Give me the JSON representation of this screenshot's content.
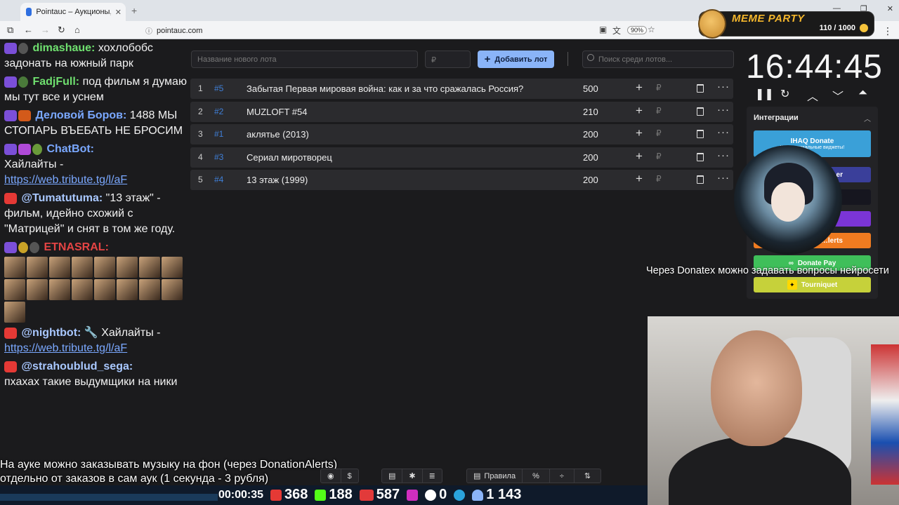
{
  "browser": {
    "tab_title": "Pointauc – Аукционы, лотереи",
    "url": "pointauc.com",
    "zoom": "90%"
  },
  "meme_party": {
    "title": "MEME PARTY",
    "count": "110 / 1000"
  },
  "chat": {
    "messages": [
      {
        "author": "dimashaue:",
        "author_color": "#6fe06f",
        "text": "хохлобобс задонать на южный парк"
      },
      {
        "author": "FadjFull:",
        "author_color": "#6fe06f",
        "text": "под фильм я думаю мы тут все и уснем"
      },
      {
        "author": "Деловой Боров:",
        "author_color": "#7aa8ff",
        "text": "1488 МЫ СТОПАРЬ ВЪЕБАТЬ НЕ БРОСИМ"
      },
      {
        "author": "ChatBot:",
        "author_color": "#7aa8ff",
        "text": "Хайлайты -",
        "link": "https://web.tribute.tg/l/aF"
      },
      {
        "author": "@Tumatutuma:",
        "author_color": "#a9c8ff",
        "text": "\"13 этаж\" - фильм, идейно схожий с \"Матрицей\" и снят в том же году."
      },
      {
        "author": "ЕTNASRAL:",
        "author_color": "#e54444",
        "text": ""
      },
      {
        "author": "@nightbot:",
        "author_color": "#a9c8ff",
        "text": "Хайлайты -",
        "link": "https://web.tribute.tg/l/aF"
      },
      {
        "author": "@strahoublud_sega:",
        "author_color": "#a9c8ff",
        "text": "пхахах такие выдумщики на ники"
      }
    ]
  },
  "form": {
    "lot_placeholder": "Название нового лота",
    "amount_placeholder": "₽",
    "add_label": "Добавить лот",
    "search_placeholder": "Поиск среди лотов..."
  },
  "lots": [
    {
      "num": "1",
      "rank": "#5",
      "name": "Забытая Первая мировая война: как и за что сражалась Россия?",
      "amount": "500"
    },
    {
      "num": "2",
      "rank": "#2",
      "name": "MUZLOFT #54",
      "amount": "210"
    },
    {
      "num": "3",
      "rank": "#1",
      "name": "аклятье (2013)",
      "amount": "200"
    },
    {
      "num": "4",
      "rank": "#3",
      "name": "Сериал миротворец",
      "amount": "200"
    },
    {
      "num": "5",
      "rank": "#4",
      "name": "13 этаж (1999)",
      "amount": "200"
    }
  ],
  "timer": {
    "value": "16:44:45"
  },
  "integrations": {
    "title": "Интеграции",
    "buttons": [
      {
        "label": "IHAQ Donate",
        "sub": "Ко… …никальные виджеты!",
        "color": "#3aa0d8"
      },
      {
        "label": "…er",
        "color": "#3a3f9a"
      },
      {
        "label": "",
        "color": "#1a1a2a"
      },
      {
        "label": "",
        "color": "#7b35d6"
      },
      {
        "label": "…lerts",
        "color": "#f07b20"
      },
      {
        "label": "Donate Pay",
        "color": "#3fbf5a"
      },
      {
        "label": "Tourniquet",
        "color": "#c6d13a"
      }
    ]
  },
  "captions": {
    "right": "Через Donatex можно задавать вопросы нейросети",
    "bottom_line1": "На ауке можно заказывать музыку на фон (через DonationAlerts)",
    "bottom_line2": "отдельно от заказов в сам аук (1 секунда - 3 рубля)"
  },
  "toolbar": {
    "rules_label": "Правила",
    "percent_label": "%"
  },
  "stats": {
    "time": "00:00:35",
    "youtube": "368",
    "kick": "188",
    "live": "587",
    "r": "0",
    "viewers": "1 143"
  }
}
